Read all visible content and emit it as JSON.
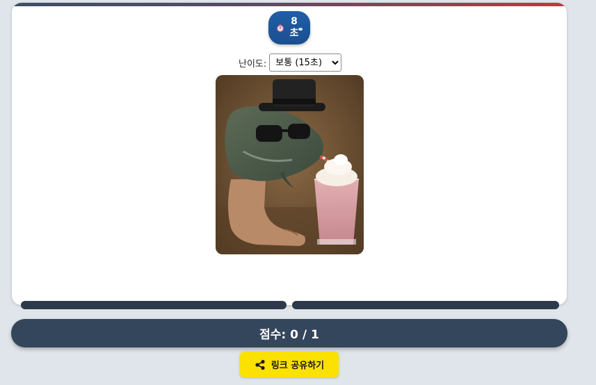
{
  "timer": {
    "icon": "stopwatch-icon",
    "value": "8\n초"
  },
  "difficulty": {
    "label": "난이도:",
    "selected": "보통 (15초)"
  },
  "score": {
    "text": "점수: 0 / 1"
  },
  "share": {
    "icon": "share-icon",
    "label": "링크 공유하기"
  },
  "colors": {
    "accent_blue": "#1f5fa6",
    "score_bg": "#34465c",
    "share_bg": "#fbe100",
    "page_bg": "#dfe5ea"
  }
}
